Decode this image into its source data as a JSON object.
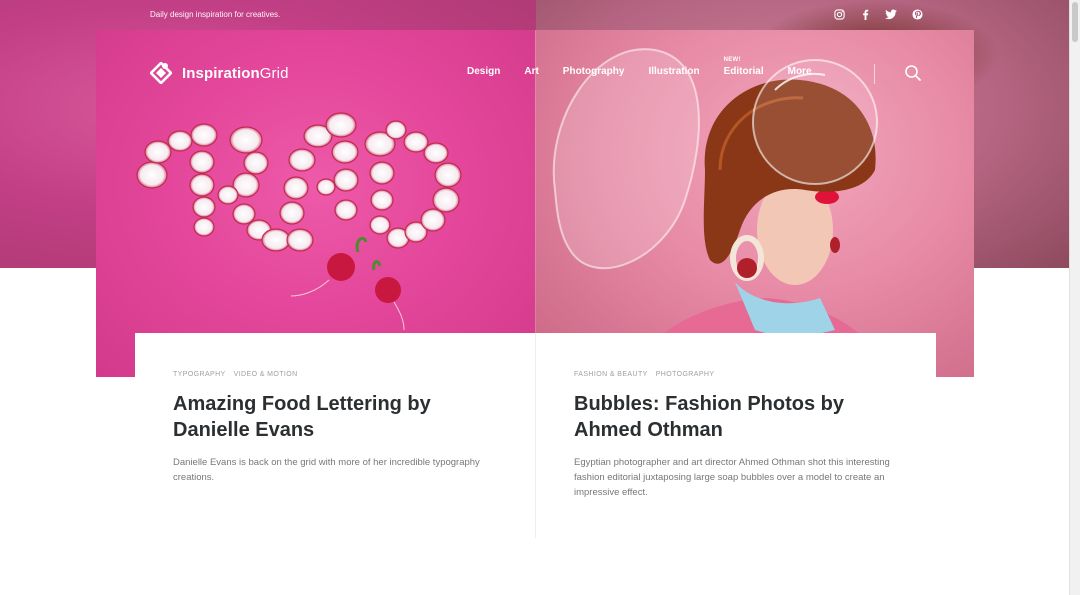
{
  "site": {
    "tagline": "Daily design inspiration for creatives.",
    "logo": {
      "bold": "Inspiration",
      "light": "Grid"
    },
    "accent": "#e4479b"
  },
  "social": [
    {
      "name": "instagram-icon"
    },
    {
      "name": "facebook-icon"
    },
    {
      "name": "twitter-icon"
    },
    {
      "name": "pinterest-icon"
    }
  ],
  "nav": {
    "items": [
      {
        "label": "Design"
      },
      {
        "label": "Art"
      },
      {
        "label": "Photography"
      },
      {
        "label": "Illustration"
      },
      {
        "label": "Editorial",
        "badge": "NEW!"
      },
      {
        "label": "More"
      }
    ]
  },
  "hero": {
    "left_art_text": "RAD"
  },
  "articles": [
    {
      "tags": [
        "TYPOGRAPHY",
        "VIDEO & MOTION"
      ],
      "title": "Amazing Food Lettering by Danielle Evans",
      "excerpt": "Danielle Evans is back on the grid with more of her incredible typography creations."
    },
    {
      "tags": [
        "FASHION & BEAUTY",
        "PHOTOGRAPHY"
      ],
      "title": "Bubbles: Fashion Photos by Ahmed Othman",
      "excerpt": "Egyptian photographer and art director Ahmed Othman shot this interesting fashion editorial juxtaposing large soap bubbles over a model to create an impressive effect."
    }
  ]
}
